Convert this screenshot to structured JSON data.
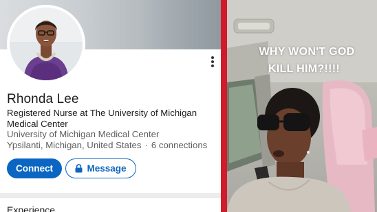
{
  "profile": {
    "name": "Rhonda Lee",
    "headline": "Registered Nurse at The University of Michigan Medical Center",
    "company": "University of Michigan Medical Center",
    "location": "Ypsilanti, Michigan, United States",
    "separator": "·",
    "connections": "6 connections",
    "connect_label": "Connect",
    "message_label": "Message",
    "section_title": "Experience",
    "accent_color": "#0a66c2"
  },
  "video": {
    "caption_line1": "WHY WON'T GOD",
    "caption_line2": "KILL HIM?!!!!"
  },
  "divider_color": "#d11a2a"
}
